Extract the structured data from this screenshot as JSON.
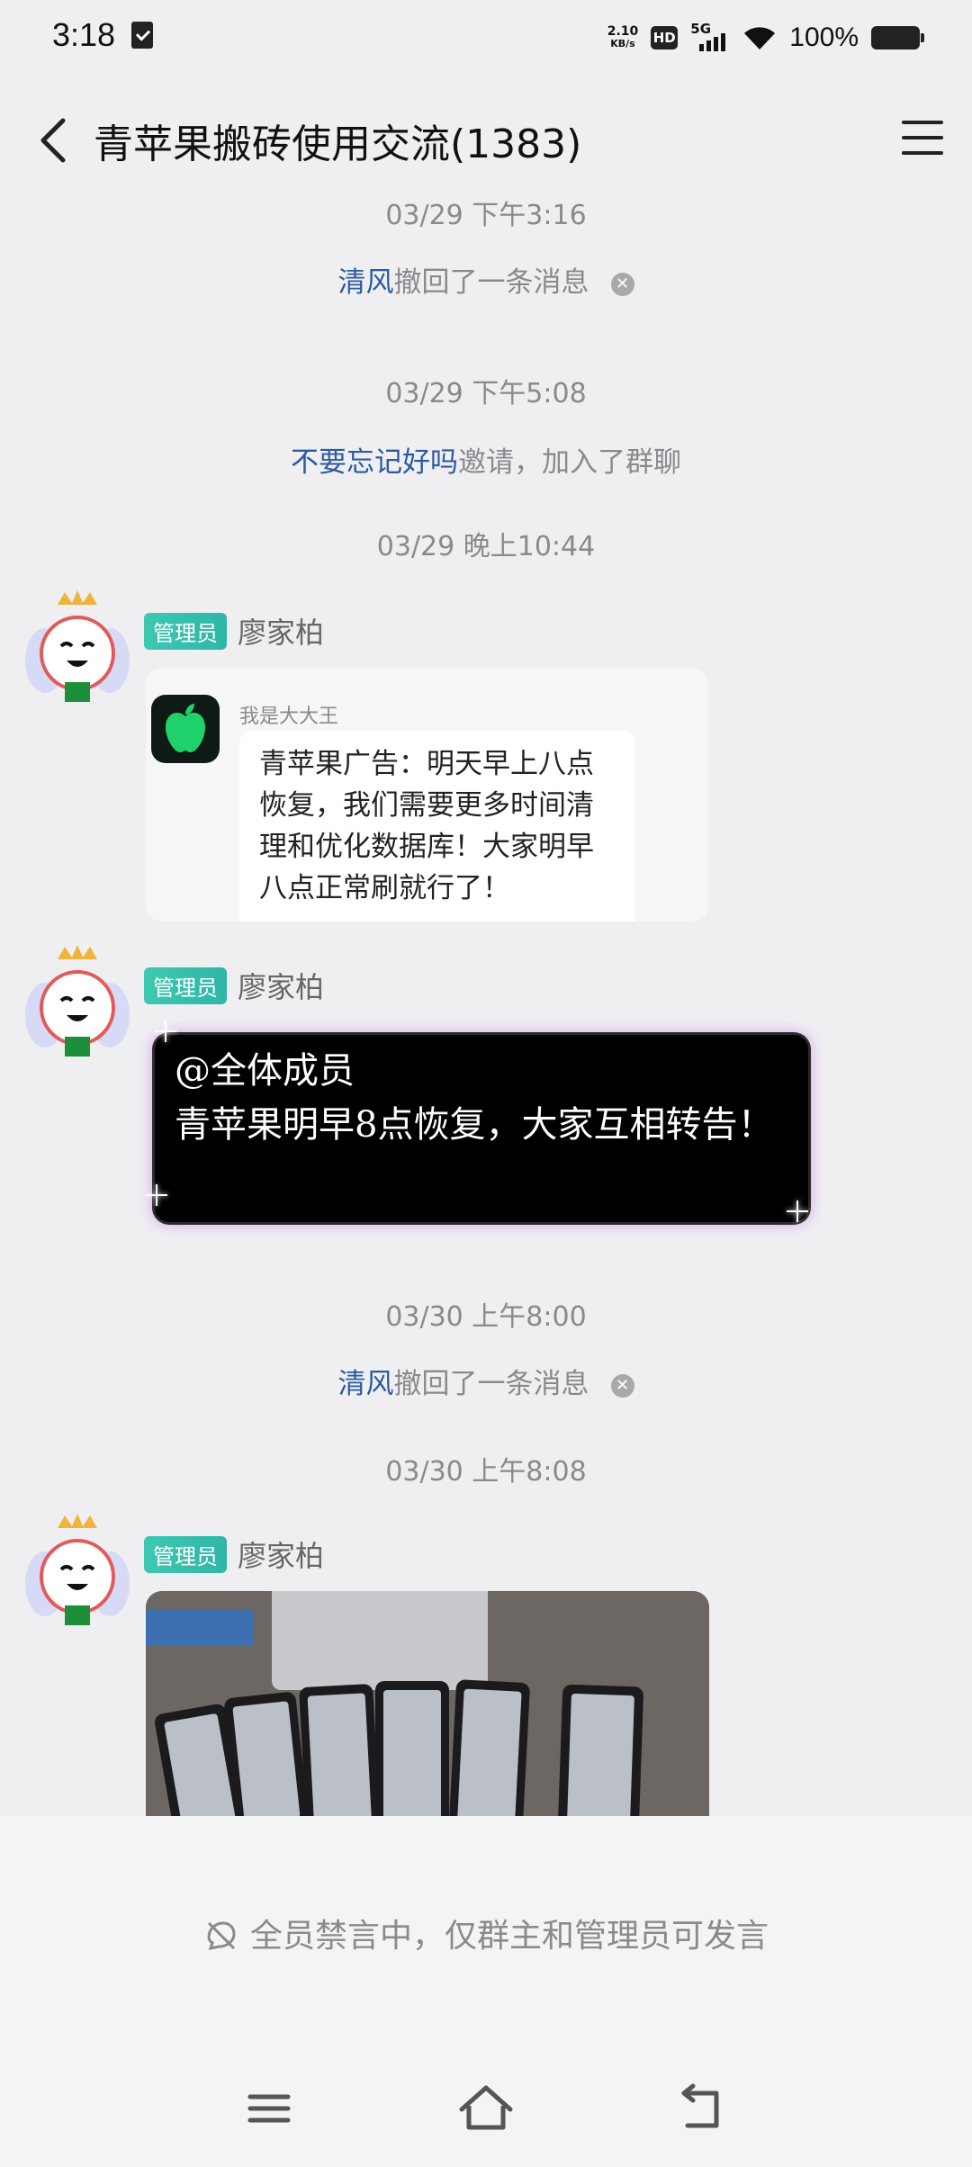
{
  "status_bar": {
    "time": "3:18",
    "net_speed_value": "2.10",
    "net_speed_unit": "KB/s",
    "hd": "HD",
    "network": "5G",
    "battery": "100%"
  },
  "header": {
    "title": "青苹果搬砖使用交流(1383)"
  },
  "messages": {
    "t1": "03/29 下午3:16",
    "recall1_name": "清风",
    "recall1_text": "撤回了一条消息",
    "t2": "03/29 下午5:08",
    "join_name": "不要忘记好吗",
    "join_text": "邀请，加入了群聊",
    "t3": "03/29 晚上10:44",
    "admin_badge": "管理员",
    "sender": "廖家柏",
    "card_inner_name": "我是大大王",
    "card_text": "青苹果广告：明天早上八点恢复，我们需要更多时间清理和优化数据库！大家明早八点正常刷就行了！",
    "fancy_line1": "@全体成员",
    "fancy_line2": "青苹果明早8点恢复，大家互相转告！",
    "t4": "03/30 上午8:00",
    "recall2_name": "清风",
    "recall2_text": "撤回了一条消息",
    "t5": "03/30 上午8:08"
  },
  "bottom": {
    "mute_text": "全员禁言中，仅群主和管理员可发言"
  },
  "icons": [
    "back-icon",
    "menu-icon",
    "recall-close-icon",
    "muted-icon",
    "nav-menu-icon",
    "nav-home-icon",
    "nav-back-icon"
  ]
}
